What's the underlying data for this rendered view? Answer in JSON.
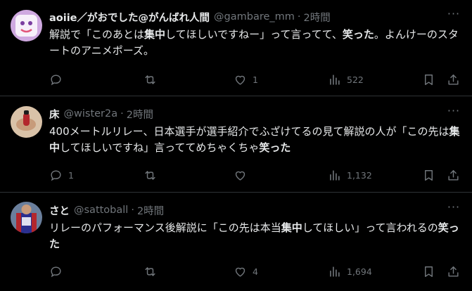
{
  "tweets": [
    {
      "name": "aoiie／がおでした@がんばれ人間",
      "handle": "@gambare_mm",
      "time": "2時間",
      "text_parts": [
        "解説で「このあとは",
        "集中",
        "してほしいですねー」って言ってて、",
        "笑った",
        "。よんけーのスタートのアニメポーズ。"
      ],
      "reply_count": "",
      "retweet_count": "",
      "like_count": "1",
      "view_count": "522"
    },
    {
      "name": "床",
      "handle": "@wister2a",
      "time": "2時間",
      "text_parts": [
        "400メートルリレー、日本選手が選手紹介でふざけてるの見て解説の人が「この先は",
        "集中",
        "してほしいですね」言っててめちゃくちゃ",
        "笑った",
        ""
      ],
      "reply_count": "1",
      "retweet_count": "",
      "like_count": "",
      "view_count": "1,132"
    },
    {
      "name": "さと",
      "handle": "@sattoball",
      "time": "2時間",
      "text_parts": [
        "リレーのパフォーマンス後解説に「この先は本当",
        "集中",
        "してほしい」って言われるの",
        "笑った",
        ""
      ],
      "reply_count": "",
      "retweet_count": "",
      "like_count": "4",
      "view_count": "1,694"
    }
  ],
  "separator": "·",
  "colors": {
    "bg": "#000000",
    "text": "#e7e9ea",
    "muted": "#71767b",
    "border": "#2f3336"
  }
}
